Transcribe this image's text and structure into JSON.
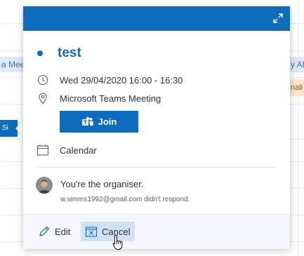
{
  "background": {
    "left_event_label": "a Meeti",
    "right_event_label": "y Af",
    "right_orange_label": "nali",
    "selected_event_label": "Si"
  },
  "event": {
    "title": "test",
    "datetime": "Wed 29/04/2020 16:00 - 16:30",
    "location": "Microsoft Teams Meeting",
    "join_label": "Join",
    "calendar": "Calendar",
    "organiser_text": "You're the organiser.",
    "response_text": "w.simms1992@gmail.com didn't respond."
  },
  "actions": {
    "edit_label": "Edit",
    "cancel_label": "Cancel"
  },
  "colors": {
    "accent": "#0f6cbd",
    "cancel_hover": "#cfe1f3"
  },
  "icons": {
    "expand": "expand-icon",
    "clock": "clock-icon",
    "location": "location-pin-icon",
    "teams": "teams-icon",
    "calendar": "calendar-icon",
    "edit": "pencil-icon",
    "cancel": "cancel-calendar-icon"
  }
}
